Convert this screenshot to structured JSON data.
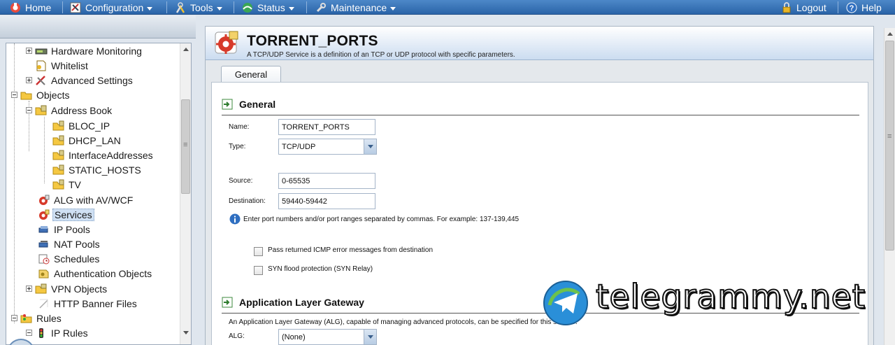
{
  "menu": {
    "home": "Home",
    "configuration": "Configuration",
    "tools": "Tools",
    "status": "Status",
    "maintenance": "Maintenance",
    "logout": "Logout",
    "help": "Help"
  },
  "tree": {
    "hardware_monitoring": "Hardware Monitoring",
    "whitelist": "Whitelist",
    "advanced_settings": "Advanced Settings",
    "objects": "Objects",
    "address_book": "Address Book",
    "bloc_ip": "BLOC_IP",
    "dhcp_lan": "DHCP_LAN",
    "interface_addresses": "InterfaceAddresses",
    "static_hosts": "STATIC_HOSTS",
    "tv": "TV",
    "alg": "ALG with AV/WCF",
    "services": "Services",
    "ip_pools": "IP Pools",
    "nat_pools": "NAT Pools",
    "schedules": "Schedules",
    "auth_objects": "Authentication Objects",
    "vpn_objects": "VPN Objects",
    "http_banner": "HTTP Banner Files",
    "rules": "Rules",
    "ip_rules": "IP Rules"
  },
  "page": {
    "title": "TORRENT_PORTS",
    "description": "A TCP/UDP Service is a definition of an TCP or UDP protocol with specific parameters.",
    "tab_general": "General"
  },
  "general": {
    "heading": "General",
    "name_label": "Name:",
    "name_value": "TORRENT_PORTS",
    "type_label": "Type:",
    "type_value": "TCP/UDP",
    "source_label": "Source:",
    "source_value": "0-65535",
    "destination_label": "Destination:",
    "destination_value": "59440-59442",
    "port_hint": "Enter port numbers and/or port ranges separated by commas. For example: 137-139,445",
    "icmp_label": "Pass returned ICMP error messages from destination",
    "syn_label": "SYN flood protection (SYN Relay)"
  },
  "alg": {
    "heading": "Application Layer Gateway",
    "description": "An Application Layer Gateway (ALG), capable of managing advanced protocols, can be specified for this service.",
    "alg_label": "ALG:",
    "alg_value": "(None)"
  },
  "watermark": {
    "text": "telegrammy.net"
  },
  "colors": {
    "menu_bar": "#2a64a8",
    "header_gradient_end": "#cbdcf0",
    "selection": "#cfe0f3"
  }
}
